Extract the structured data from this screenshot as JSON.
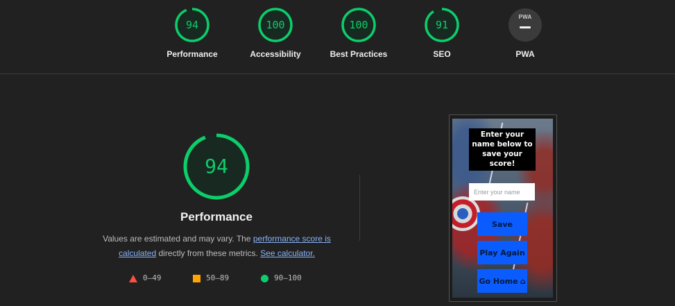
{
  "summary_gauges": [
    {
      "label": "Performance",
      "score": "94",
      "fraction": 0.94,
      "color": "#0cce6b"
    },
    {
      "label": "Accessibility",
      "score": "100",
      "fraction": 1.0,
      "color": "#0cce6b"
    },
    {
      "label": "Best Practices",
      "score": "100",
      "fraction": 1.0,
      "color": "#0cce6b"
    },
    {
      "label": "SEO",
      "score": "91",
      "fraction": 0.91,
      "color": "#0cce6b"
    }
  ],
  "pwa": {
    "label": "PWA",
    "badge_text": "PWA"
  },
  "main": {
    "score": "94",
    "fraction": 0.94,
    "title": "Performance",
    "desc_prefix": "Values are estimated and may vary. The ",
    "desc_link1": "performance score is calculated",
    "desc_middle": " directly from these metrics. ",
    "desc_link2": "See calculator."
  },
  "legend": [
    {
      "range": "0–49",
      "icon": "triangle-fail-icon",
      "color": "#ff4e42"
    },
    {
      "range": "50–89",
      "icon": "square-average-icon",
      "color": "#ffa400"
    },
    {
      "range": "90–100",
      "icon": "circle-pass-icon",
      "color": "#0cce6b"
    }
  ],
  "screenshot": {
    "headline": "Enter your name below to save your score!",
    "input_placeholder": "Enter your name",
    "save_label": "Save",
    "play_again_label": "Play Again",
    "go_home_label": "Go Home",
    "home_icon": "home-icon"
  }
}
